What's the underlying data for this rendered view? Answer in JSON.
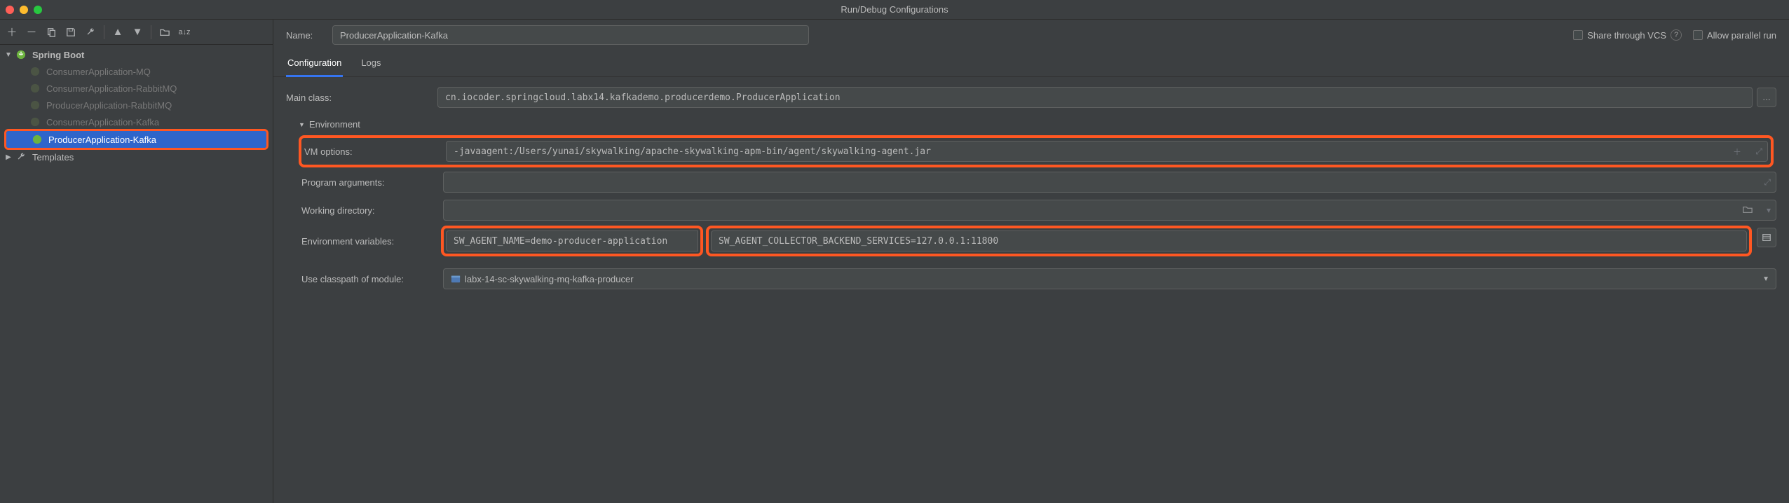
{
  "window": {
    "title": "Run/Debug Configurations"
  },
  "sidebar": {
    "root_label": "Spring Boot",
    "templates_label": "Templates",
    "items": [
      {
        "label": "ConsumerApplication-MQ"
      },
      {
        "label": "ConsumerApplication-RabbitMQ"
      },
      {
        "label": "ProducerApplication-RabbitMQ"
      },
      {
        "label": "ConsumerApplication-Kafka"
      },
      {
        "label": "ProducerApplication-Kafka",
        "selected": true
      }
    ]
  },
  "name_label": "Name:",
  "name_value": "ProducerApplication-Kafka",
  "share_label": "Share through VCS",
  "parallel_label": "Allow parallel run",
  "tabs": {
    "configuration": "Configuration",
    "logs": "Logs"
  },
  "form": {
    "main_class_label": "Main class:",
    "main_class_value": "cn.iocoder.springcloud.labx14.kafkademo.producerdemo.ProducerApplication",
    "environment_header": "Environment",
    "vm_options_label": "VM options:",
    "vm_options_value": "-javaagent:/Users/yunai/skywalking/apache-skywalking-apm-bin/agent/skywalking-agent.jar",
    "program_args_label": "Program arguments:",
    "program_args_value": "",
    "working_dir_label": "Working directory:",
    "working_dir_value": "",
    "env_vars_label": "Environment variables:",
    "env_vars_value_a": "SW_AGENT_NAME=demo-producer-application",
    "env_vars_value_b": "SW_AGENT_COLLECTOR_BACKEND_SERVICES=127.0.0.1:11800",
    "classpath_label": "Use classpath of module:",
    "classpath_value": "labx-14-sc-skywalking-mq-kafka-producer"
  }
}
